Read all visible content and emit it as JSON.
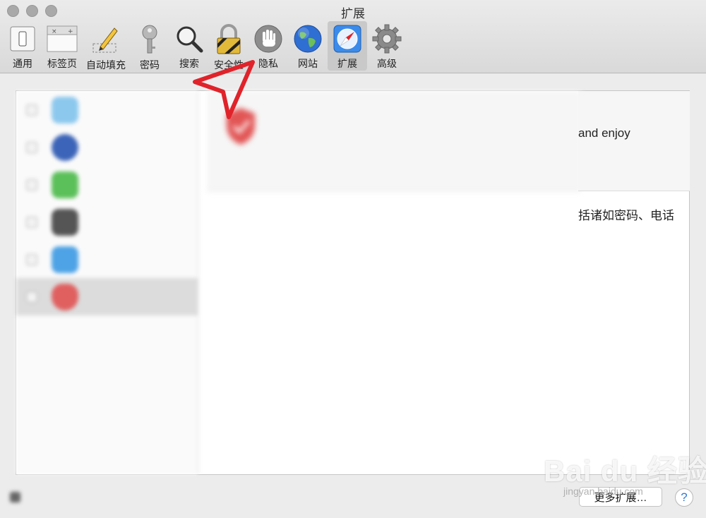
{
  "window": {
    "title": "扩展"
  },
  "toolbar": {
    "items": [
      {
        "label": "通用",
        "icon": "switch-icon"
      },
      {
        "label": "标签页",
        "icon": "tabs-icon"
      },
      {
        "label": "自动填充",
        "icon": "pencil-icon"
      },
      {
        "label": "密码",
        "icon": "key-icon"
      },
      {
        "label": "搜索",
        "icon": "magnifier-icon"
      },
      {
        "label": "安全性",
        "icon": "padlock-icon"
      },
      {
        "label": "隐私",
        "icon": "hand-icon"
      },
      {
        "label": "网站",
        "icon": "globe-icon"
      },
      {
        "label": "扩展",
        "icon": "compass-icon",
        "active": true
      },
      {
        "label": "高级",
        "icon": "gear-icon"
      }
    ]
  },
  "detail": {
    "description_visible": "and enjoy",
    "permissions_visible": "括诸如密码、电话"
  },
  "footer": {
    "more_extensions": "更多扩展…",
    "help": "?"
  },
  "watermark": {
    "main": "Bai du 经验",
    "sub": "jingyan.baidu.com"
  },
  "colors": {
    "accent": "#3478d8",
    "annotation": "#e0232a",
    "selected_row": "#dcdcdc"
  }
}
